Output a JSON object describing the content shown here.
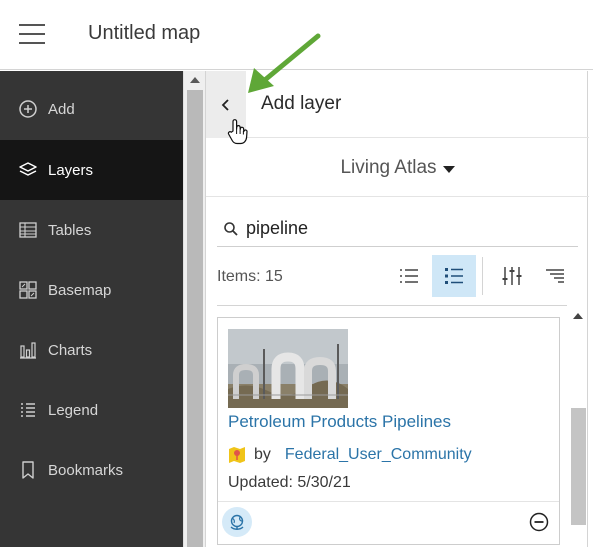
{
  "header": {
    "title": "Untitled map"
  },
  "nav": {
    "items": [
      {
        "label": "Add",
        "icon": "plus-circle-icon",
        "active": false
      },
      {
        "label": "Layers",
        "icon": "layers-icon",
        "active": true
      },
      {
        "label": "Tables",
        "icon": "table-icon",
        "active": false
      },
      {
        "label": "Basemap",
        "icon": "basemap-icon",
        "active": false
      },
      {
        "label": "Charts",
        "icon": "chart-icon",
        "active": false
      },
      {
        "label": "Legend",
        "icon": "legend-icon",
        "active": false
      },
      {
        "label": "Bookmarks",
        "icon": "bookmark-icon",
        "active": false
      }
    ]
  },
  "panel": {
    "title": "Add layer",
    "source": "Living Atlas",
    "search_value": "pipeline",
    "items_count": "Items: 15",
    "view_mode": "detailed-list"
  },
  "result": {
    "title": "Petroleum Products Pipelines",
    "by_label": "by",
    "owner": "Federal_User_Community",
    "updated": "Updated: 5/30/21"
  },
  "colors": {
    "nav_bg": "#353535",
    "nav_active_bg": "#151515",
    "link": "#2b74a8",
    "active_toggle_bg": "#cfe7f7",
    "annotation_arrow": "#5fa737"
  }
}
